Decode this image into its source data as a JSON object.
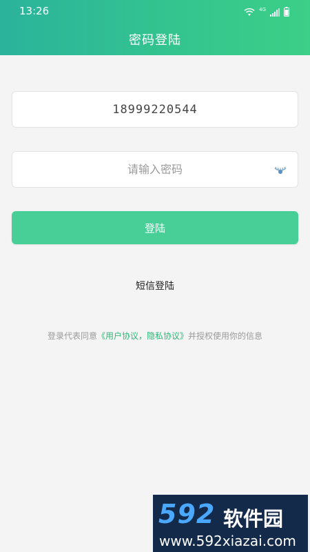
{
  "status_bar": {
    "time": "13:26",
    "network": "4G",
    "icons": [
      "wifi-icon",
      "signal-icon",
      "battery-icon"
    ]
  },
  "header": {
    "title": "密码登陆"
  },
  "form": {
    "phone_value": "18999220544",
    "password_placeholder": "请输入密码",
    "password_icon": "eye-icon",
    "login_label": "登陆"
  },
  "alt_login": {
    "label": "短信登陆"
  },
  "agreement": {
    "prefix": "登录代表同意",
    "link_text": "《用户协议，隐私协议》",
    "suffix": "并授权使用你的信息"
  },
  "watermark": {
    "number": "592",
    "name": "软件园",
    "url": "www.592xiazai.com"
  },
  "colors": {
    "header_gradient_start": "#2bb39c",
    "header_gradient_end": "#3ccf87",
    "primary_button": "#47cf97",
    "link": "#2fb878",
    "background": "#f4f4f4"
  }
}
